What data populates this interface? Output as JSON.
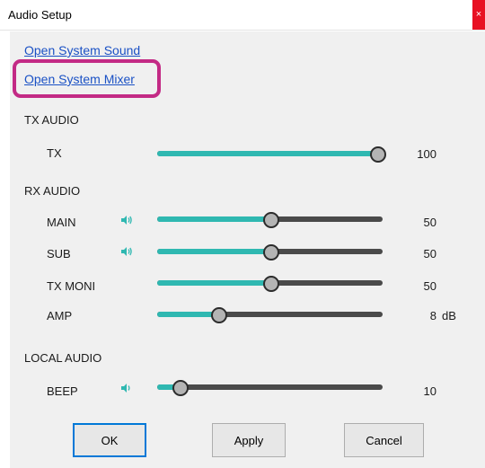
{
  "window": {
    "title": "Audio Setup",
    "close_glyph": "×"
  },
  "links": {
    "system_sound": "Open System Sound",
    "system_mixer": "Open System Mixer"
  },
  "tx_audio": {
    "section": "TX AUDIO",
    "tx": {
      "label": "TX",
      "value": "100",
      "level_pct": 100
    }
  },
  "rx_audio": {
    "section": "RX AUDIO",
    "main": {
      "label": "MAIN",
      "value": "50",
      "level_pct": 50,
      "icon": "speaker-icon"
    },
    "sub": {
      "label": "SUB",
      "value": "50",
      "level_pct": 50,
      "icon": "speaker-icon"
    },
    "tx_moni": {
      "label": "TX MONI",
      "value": "50",
      "level_pct": 50
    },
    "amp": {
      "label": "AMP",
      "value": "8",
      "unit": "dB",
      "level_pct": 27
    }
  },
  "local_audio": {
    "section": "LOCAL AUDIO",
    "beep": {
      "label": "BEEP",
      "value": "10",
      "level_pct": 10,
      "icon": "speaker-icon"
    }
  },
  "buttons": {
    "ok": "OK",
    "apply": "Apply",
    "cancel": "Cancel"
  },
  "colors": {
    "accent_fill": "#2fb8b1",
    "highlight": "#c32a85",
    "link": "#1a51c5"
  }
}
